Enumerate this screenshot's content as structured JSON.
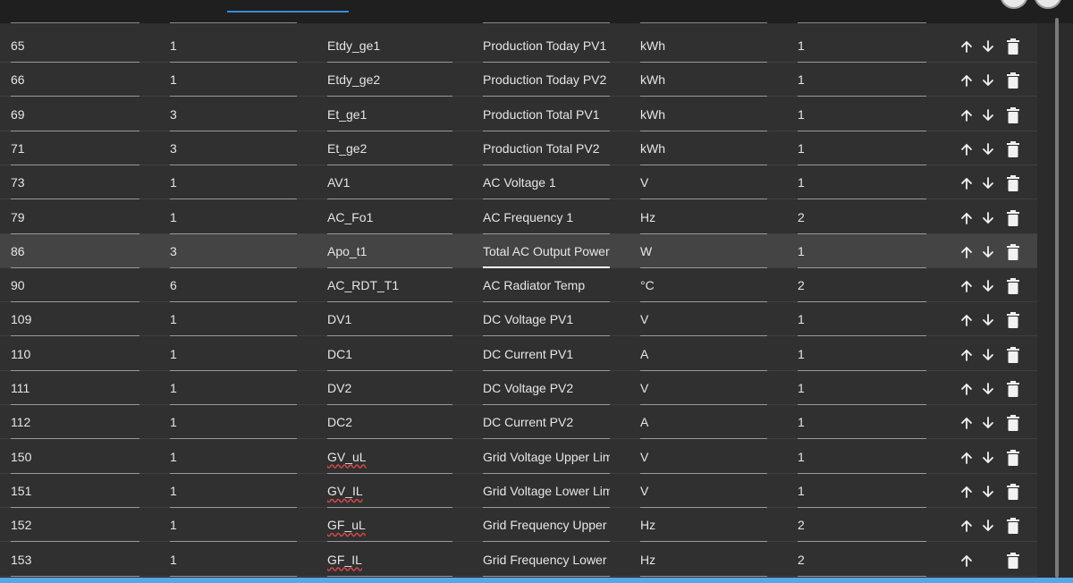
{
  "rows": [
    {
      "address": "65",
      "length": "1",
      "name": "Etdy_ge1",
      "description": "Production Today PV1",
      "unit": "kWh",
      "factor": "1",
      "up": true,
      "down": true
    },
    {
      "address": "66",
      "length": "1",
      "name": "Etdy_ge2",
      "description": "Production Today PV2",
      "unit": "kWh",
      "factor": "1",
      "up": true,
      "down": true
    },
    {
      "address": "69",
      "length": "3",
      "name": "Et_ge1",
      "description": "Production Total PV1",
      "unit": "kWh",
      "factor": "1",
      "up": true,
      "down": true
    },
    {
      "address": "71",
      "length": "3",
      "name": "Et_ge2",
      "description": "Production Total PV2",
      "unit": "kWh",
      "factor": "1",
      "up": true,
      "down": true
    },
    {
      "address": "73",
      "length": "1",
      "name": "AV1",
      "description": "AC Voltage 1",
      "unit": "V",
      "factor": "1",
      "up": true,
      "down": true
    },
    {
      "address": "79",
      "length": "1",
      "name": "AC_Fo1",
      "description": "AC Frequency 1",
      "unit": "Hz",
      "factor": "2",
      "up": true,
      "down": true
    },
    {
      "address": "86",
      "length": "3",
      "name": "Apo_t1",
      "description": "Total AC Output Power",
      "unit": "W",
      "factor": "1",
      "up": true,
      "down": true,
      "highlight": true
    },
    {
      "address": "90",
      "length": "6",
      "name": "AC_RDT_T1",
      "description": "AC Radiator Temp",
      "unit": "°C",
      "factor": "2",
      "up": true,
      "down": true
    },
    {
      "address": "109",
      "length": "1",
      "name": "DV1",
      "description": "DC Voltage PV1",
      "unit": "V",
      "factor": "1",
      "up": true,
      "down": true
    },
    {
      "address": "110",
      "length": "1",
      "name": "DC1",
      "description": "DC Current PV1",
      "unit": "A",
      "factor": "1",
      "up": true,
      "down": true
    },
    {
      "address": "111",
      "length": "1",
      "name": "DV2",
      "description": "DC Voltage PV2",
      "unit": "V",
      "factor": "1",
      "up": true,
      "down": true
    },
    {
      "address": "112",
      "length": "1",
      "name": "DC2",
      "description": "DC Current PV2",
      "unit": "A",
      "factor": "1",
      "up": true,
      "down": true
    },
    {
      "address": "150",
      "length": "1",
      "name": "GV_uL",
      "description": "Grid Voltage Upper Lim",
      "unit": "V",
      "factor": "1",
      "up": true,
      "down": true,
      "misspelled": true
    },
    {
      "address": "151",
      "length": "1",
      "name": "GV_IL",
      "description": "Grid Voltage Lower Lim",
      "unit": "V",
      "factor": "1",
      "up": true,
      "down": true,
      "misspelled": true
    },
    {
      "address": "152",
      "length": "1",
      "name": "GF_uL",
      "description": "Grid Frequency Upper",
      "unit": "Hz",
      "factor": "2",
      "up": true,
      "down": true,
      "misspelled": true
    },
    {
      "address": "153",
      "length": "1",
      "name": "GF_IL",
      "description": "Grid Frequency Lower",
      "unit": "Hz",
      "factor": "2",
      "up": true,
      "down": false,
      "misspelled": true
    }
  ],
  "icons": {
    "up": "arrow-up-icon",
    "down": "arrow-down-icon",
    "delete": "trash-icon"
  },
  "colors": {
    "accent": "#58a6e8",
    "spellcheck": "#d84a4a",
    "row_highlight": "#444444"
  }
}
